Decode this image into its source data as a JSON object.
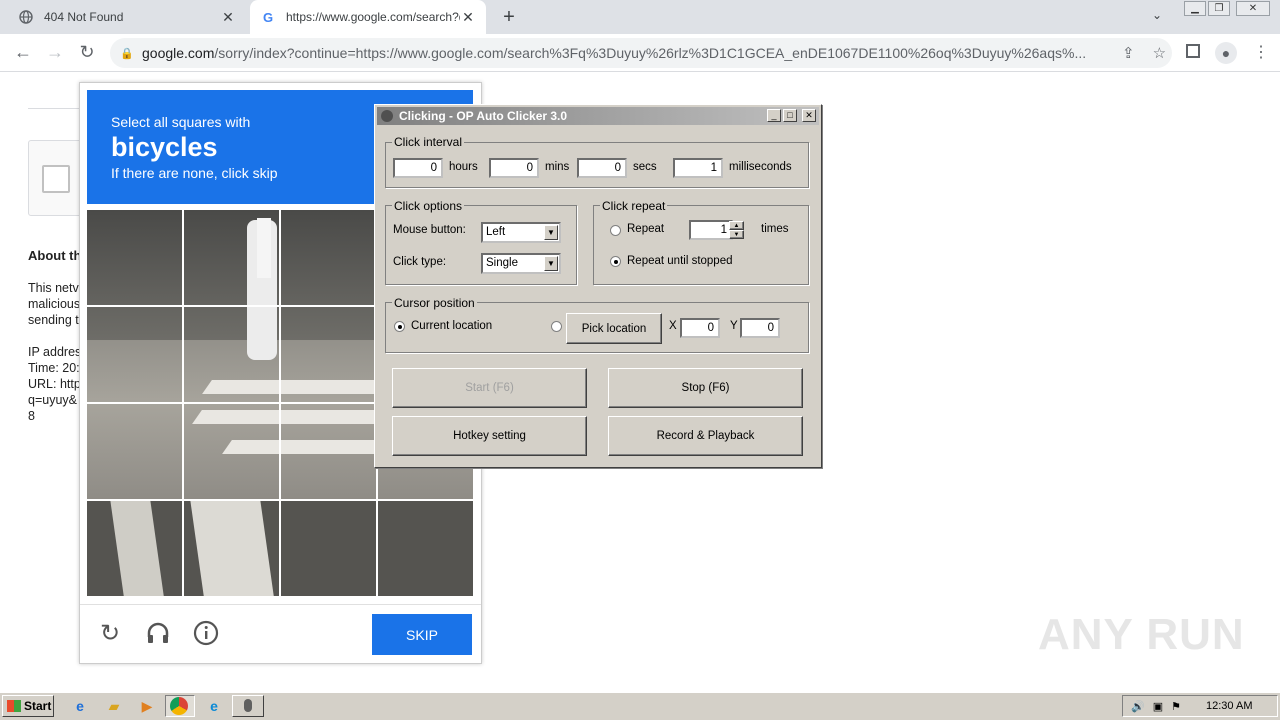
{
  "browser": {
    "tabs": [
      {
        "title": "404 Not Found",
        "icon": "globe-icon"
      },
      {
        "title": "https://www.google.com/search?q=",
        "icon": "google-icon"
      }
    ],
    "url_host": "google.com",
    "url_rest": "/sorry/index?continue=https://www.google.com/search%3Fq%3Duyuy%26rlz%3D1C1GCEA_enDE1067DE1100%26oq%3Duyuy%26aqs%..."
  },
  "page": {
    "about_heading": "About th",
    "lines": [
      "This netv",
      "malicious",
      "sending t",
      "",
      "IP addres",
      "Time: 20:",
      "URL: http",
      "q=uyuy&",
      "8"
    ]
  },
  "captcha": {
    "instruction": "Select all squares with",
    "target": "bicycles",
    "subtext": "If there are none, click skip",
    "skip_label": "SKIP"
  },
  "clicker": {
    "title": "Clicking - OP Auto Clicker 3.0",
    "interval": {
      "label": "Click interval",
      "hours": "0",
      "hours_label": "hours",
      "mins": "0",
      "mins_label": "mins",
      "secs": "0",
      "secs_label": "secs",
      "ms": "1",
      "ms_label": "milliseconds"
    },
    "options": {
      "label": "Click options",
      "mouse_label": "Mouse button:",
      "mouse_value": "Left",
      "type_label": "Click type:",
      "type_value": "Single"
    },
    "repeat": {
      "label": "Click repeat",
      "repeat_label": "Repeat",
      "repeat_value": "1",
      "times_label": "times",
      "until_label": "Repeat until stopped"
    },
    "cursor": {
      "label": "Cursor position",
      "current_label": "Current location",
      "pick_label": "Pick location",
      "x_label": "X",
      "x_value": "0",
      "y_label": "Y",
      "y_value": "0"
    },
    "buttons": {
      "start": "Start (F6)",
      "stop": "Stop (F6)",
      "hotkey": "Hotkey setting",
      "record": "Record & Playback"
    }
  },
  "taskbar": {
    "start_label": "Start",
    "clock": "12:30 AM"
  },
  "watermark": "ANY RUN",
  "colors": {
    "google_blue": "#1a73e8",
    "win_gray": "#d4d0c8"
  }
}
